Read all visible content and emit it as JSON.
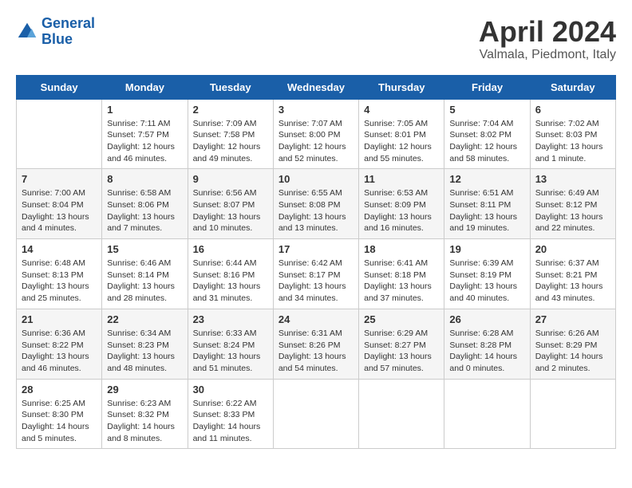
{
  "header": {
    "logo_line1": "General",
    "logo_line2": "Blue",
    "month": "April 2024",
    "location": "Valmala, Piedmont, Italy"
  },
  "days_of_week": [
    "Sunday",
    "Monday",
    "Tuesday",
    "Wednesday",
    "Thursday",
    "Friday",
    "Saturday"
  ],
  "weeks": [
    [
      {
        "day": "",
        "info": ""
      },
      {
        "day": "1",
        "info": "Sunrise: 7:11 AM\nSunset: 7:57 PM\nDaylight: 12 hours\nand 46 minutes."
      },
      {
        "day": "2",
        "info": "Sunrise: 7:09 AM\nSunset: 7:58 PM\nDaylight: 12 hours\nand 49 minutes."
      },
      {
        "day": "3",
        "info": "Sunrise: 7:07 AM\nSunset: 8:00 PM\nDaylight: 12 hours\nand 52 minutes."
      },
      {
        "day": "4",
        "info": "Sunrise: 7:05 AM\nSunset: 8:01 PM\nDaylight: 12 hours\nand 55 minutes."
      },
      {
        "day": "5",
        "info": "Sunrise: 7:04 AM\nSunset: 8:02 PM\nDaylight: 12 hours\nand 58 minutes."
      },
      {
        "day": "6",
        "info": "Sunrise: 7:02 AM\nSunset: 8:03 PM\nDaylight: 13 hours\nand 1 minute."
      }
    ],
    [
      {
        "day": "7",
        "info": "Sunrise: 7:00 AM\nSunset: 8:04 PM\nDaylight: 13 hours\nand 4 minutes."
      },
      {
        "day": "8",
        "info": "Sunrise: 6:58 AM\nSunset: 8:06 PM\nDaylight: 13 hours\nand 7 minutes."
      },
      {
        "day": "9",
        "info": "Sunrise: 6:56 AM\nSunset: 8:07 PM\nDaylight: 13 hours\nand 10 minutes."
      },
      {
        "day": "10",
        "info": "Sunrise: 6:55 AM\nSunset: 8:08 PM\nDaylight: 13 hours\nand 13 minutes."
      },
      {
        "day": "11",
        "info": "Sunrise: 6:53 AM\nSunset: 8:09 PM\nDaylight: 13 hours\nand 16 minutes."
      },
      {
        "day": "12",
        "info": "Sunrise: 6:51 AM\nSunset: 8:11 PM\nDaylight: 13 hours\nand 19 minutes."
      },
      {
        "day": "13",
        "info": "Sunrise: 6:49 AM\nSunset: 8:12 PM\nDaylight: 13 hours\nand 22 minutes."
      }
    ],
    [
      {
        "day": "14",
        "info": "Sunrise: 6:48 AM\nSunset: 8:13 PM\nDaylight: 13 hours\nand 25 minutes."
      },
      {
        "day": "15",
        "info": "Sunrise: 6:46 AM\nSunset: 8:14 PM\nDaylight: 13 hours\nand 28 minutes."
      },
      {
        "day": "16",
        "info": "Sunrise: 6:44 AM\nSunset: 8:16 PM\nDaylight: 13 hours\nand 31 minutes."
      },
      {
        "day": "17",
        "info": "Sunrise: 6:42 AM\nSunset: 8:17 PM\nDaylight: 13 hours\nand 34 minutes."
      },
      {
        "day": "18",
        "info": "Sunrise: 6:41 AM\nSunset: 8:18 PM\nDaylight: 13 hours\nand 37 minutes."
      },
      {
        "day": "19",
        "info": "Sunrise: 6:39 AM\nSunset: 8:19 PM\nDaylight: 13 hours\nand 40 minutes."
      },
      {
        "day": "20",
        "info": "Sunrise: 6:37 AM\nSunset: 8:21 PM\nDaylight: 13 hours\nand 43 minutes."
      }
    ],
    [
      {
        "day": "21",
        "info": "Sunrise: 6:36 AM\nSunset: 8:22 PM\nDaylight: 13 hours\nand 46 minutes."
      },
      {
        "day": "22",
        "info": "Sunrise: 6:34 AM\nSunset: 8:23 PM\nDaylight: 13 hours\nand 48 minutes."
      },
      {
        "day": "23",
        "info": "Sunrise: 6:33 AM\nSunset: 8:24 PM\nDaylight: 13 hours\nand 51 minutes."
      },
      {
        "day": "24",
        "info": "Sunrise: 6:31 AM\nSunset: 8:26 PM\nDaylight: 13 hours\nand 54 minutes."
      },
      {
        "day": "25",
        "info": "Sunrise: 6:29 AM\nSunset: 8:27 PM\nDaylight: 13 hours\nand 57 minutes."
      },
      {
        "day": "26",
        "info": "Sunrise: 6:28 AM\nSunset: 8:28 PM\nDaylight: 14 hours\nand 0 minutes."
      },
      {
        "day": "27",
        "info": "Sunrise: 6:26 AM\nSunset: 8:29 PM\nDaylight: 14 hours\nand 2 minutes."
      }
    ],
    [
      {
        "day": "28",
        "info": "Sunrise: 6:25 AM\nSunset: 8:30 PM\nDaylight: 14 hours\nand 5 minutes."
      },
      {
        "day": "29",
        "info": "Sunrise: 6:23 AM\nSunset: 8:32 PM\nDaylight: 14 hours\nand 8 minutes."
      },
      {
        "day": "30",
        "info": "Sunrise: 6:22 AM\nSunset: 8:33 PM\nDaylight: 14 hours\nand 11 minutes."
      },
      {
        "day": "",
        "info": ""
      },
      {
        "day": "",
        "info": ""
      },
      {
        "day": "",
        "info": ""
      },
      {
        "day": "",
        "info": ""
      }
    ]
  ]
}
